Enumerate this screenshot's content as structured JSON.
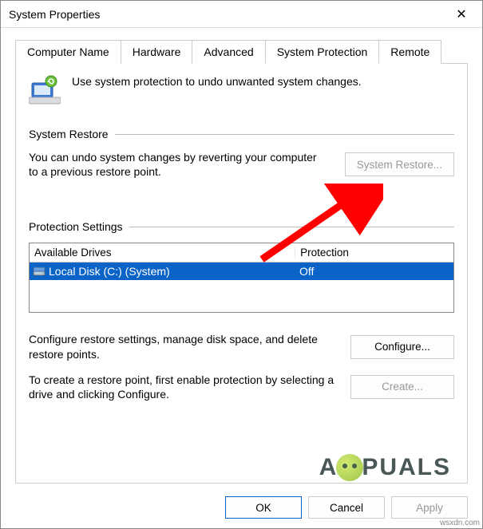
{
  "window": {
    "title": "System Properties",
    "close_glyph": "✕"
  },
  "tabs": {
    "items": [
      {
        "label": "Computer Name"
      },
      {
        "label": "Hardware"
      },
      {
        "label": "Advanced"
      },
      {
        "label": "System Protection"
      },
      {
        "label": "Remote"
      }
    ],
    "active_index": 3
  },
  "intro": {
    "text": "Use system protection to undo unwanted system changes."
  },
  "restore_section": {
    "heading": "System Restore",
    "description": "You can undo system changes by reverting your computer to a previous restore point.",
    "button_label": "System Restore...",
    "button_enabled": false
  },
  "protection_section": {
    "heading": "Protection Settings",
    "columns": {
      "col1": "Available Drives",
      "col2": "Protection"
    },
    "drives": [
      {
        "name": "Local Disk (C:) (System)",
        "protection": "Off",
        "selected": true
      }
    ],
    "configure_description": "Configure restore settings, manage disk space, and delete restore points.",
    "configure_button_label": "Configure...",
    "create_description": "To create a restore point, first enable protection by selecting a drive and clicking Configure.",
    "create_button_label": "Create...",
    "create_button_enabled": false
  },
  "footer": {
    "ok": "OK",
    "cancel": "Cancel",
    "apply": "Apply",
    "apply_enabled": false
  },
  "watermark": {
    "left": "A",
    "right": "PUALS",
    "url": "wsxdn.com"
  }
}
